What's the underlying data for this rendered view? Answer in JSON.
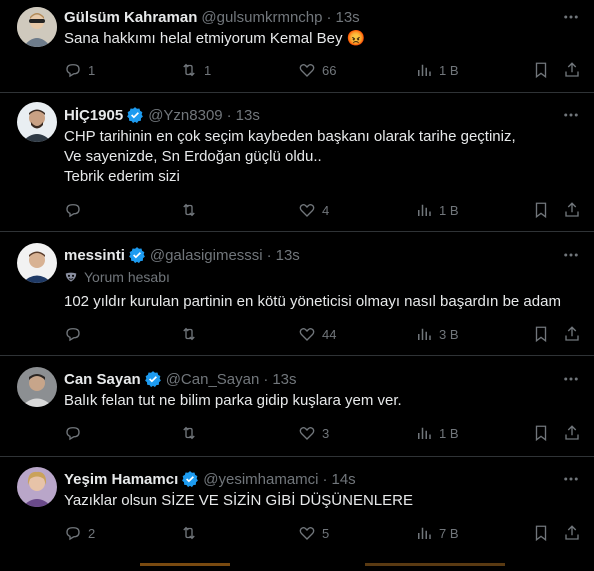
{
  "tweets": [
    {
      "name": "Gülsüm Kahraman",
      "handle": "@gulsumkrmnchp",
      "time": "13s",
      "verified": false,
      "text": "Sana hakkımı helal etmiyorum Kemal Bey 😡",
      "replies": "1",
      "retweets": "1",
      "likes": "66",
      "views": "1 B",
      "avatar_icon": "user-photo-gulsum"
    },
    {
      "name": "HİÇ1905",
      "handle": "@Yzn8309",
      "time": "13s",
      "verified": true,
      "text_lines": [
        "CHP tarihinin en çok seçim kaybeden başkanı olarak tarihe geçtiniz,",
        "Ve sayenizde,  Sn Erdoğan  güçlü oldu..",
        "Tebrik ederim sizi"
      ],
      "replies": "",
      "retweets": "",
      "likes": "4",
      "views": "1 B"
    },
    {
      "name": "messinti",
      "handle": "@galasigimesssi",
      "time": "13s",
      "verified": true,
      "label": "Yorum hesabı",
      "label_icon": "mask-icon",
      "text": "102 yıldır kurulan partinin en kötü yöneticisi olmayı nasıl başardın be adam",
      "replies": "",
      "retweets": "",
      "likes": "44",
      "views": "3 B"
    },
    {
      "name": "Can Sayan",
      "handle": "@Can_Sayan",
      "time": "13s",
      "verified": true,
      "text": "Balık felan tut ne bilim parka gidip kuşlara yem ver.",
      "replies": "",
      "retweets": "",
      "likes": "3",
      "views": "1 B"
    },
    {
      "name": "Yeşim Hamamcı",
      "handle": "@yesimhamamci",
      "time": "14s",
      "verified": true,
      "text": "Yazıklar olsun SİZE VE SİZİN GİBİ DÜŞÜNENLERE",
      "replies": "2",
      "retweets": "",
      "likes": "5",
      "views": "7 B"
    }
  ],
  "dot": "·",
  "colors": {
    "background": "#000000",
    "text": "#e7e9ea",
    "muted": "#71767b",
    "verified": "#1d9bf0",
    "divider": "#2f3336"
  }
}
